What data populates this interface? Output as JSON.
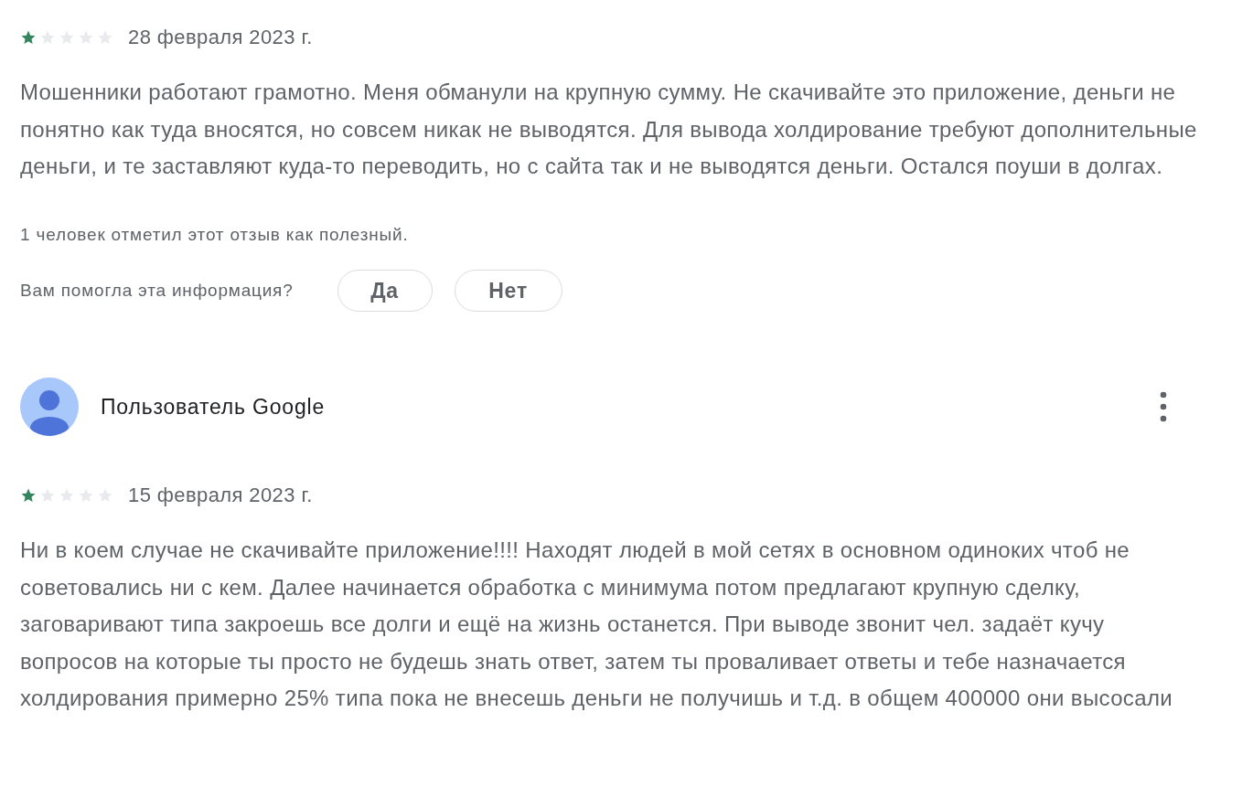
{
  "reviews": [
    {
      "stars": 1,
      "date": "28 февраля 2023 г.",
      "text": "Мошенники работают грамотно. Меня обманули на крупную сумму. Не скачивайте это приложение, деньги не понятно как туда вносятся, но совсем никак не выводятся. Для вывода холдирование требуют дополнительные деньги, и те заставляют куда-то переводить, но с сайта так и не выводятся деньги. Остался поуши в долгах.",
      "helpful_count": "1 человек отметил этот отзыв как полезный.",
      "helpful_question": "Вам помогла эта информация?",
      "votes": [
        "Да",
        "Нет"
      ]
    },
    {
      "author": "Пользователь Google",
      "stars": 1,
      "date": "15 февраля 2023 г.",
      "text": "Ни в коем случае не скачивайте приложение!!!! Находят людей в мой сетях в основном одиноких чтоб не советовались ни с кем. Далее начинается обработка с минимума потом предлагают крупную сделку, заговаривают типа закроешь все долги и ещё на жизнь останется. При выводе звонит чел. задаёт кучу вопросов на которые ты просто не будешь знать ответ, затем ты проваливает ответы и тебе назначается холдирования примерно 25% типа пока не внесешь деньги не получишь и т.д. в общем 400000 они высосали"
    }
  ]
}
